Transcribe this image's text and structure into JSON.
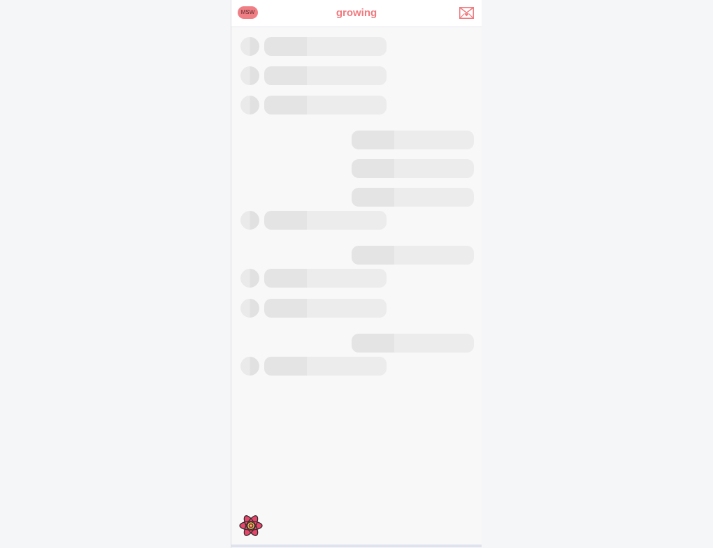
{
  "header": {
    "badge_label": "MSW",
    "title": "growing",
    "mail_icon": "envelope-heart-icon"
  },
  "colors": {
    "accent": "#f07a7f",
    "badge_bg": "#f07f85",
    "skeleton_light": "#ececec",
    "skeleton_dark": "#e4e4e4",
    "page_bg": "#f8f8f9"
  },
  "feed": {
    "loading": true,
    "placeholders": [
      {
        "side": "left",
        "avatar": true
      },
      {
        "side": "left",
        "avatar": true
      },
      {
        "side": "left",
        "avatar": true
      },
      {
        "side": "right",
        "avatar": false
      },
      {
        "side": "right",
        "avatar": false
      },
      {
        "side": "right",
        "avatar": false
      },
      {
        "side": "left",
        "avatar": true
      },
      {
        "side": "right",
        "avatar": false
      },
      {
        "side": "left",
        "avatar": true
      },
      {
        "side": "left",
        "avatar": true
      },
      {
        "side": "right",
        "avatar": false
      },
      {
        "side": "left",
        "avatar": true
      }
    ]
  },
  "footer": {
    "logo_icon": "react-atom-icon"
  }
}
